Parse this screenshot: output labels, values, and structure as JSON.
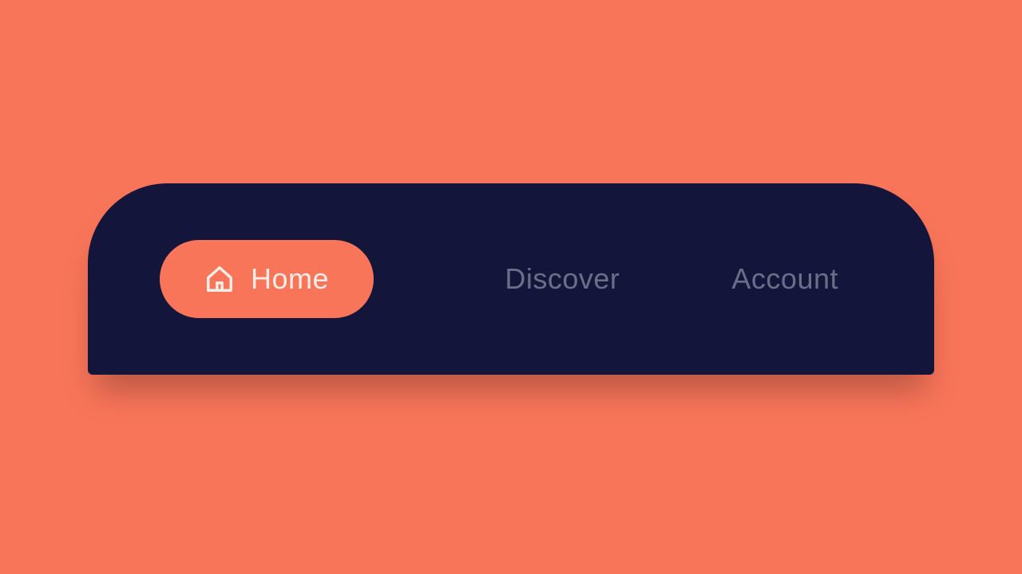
{
  "nav": {
    "items": [
      {
        "label": "Home",
        "active": true,
        "icon": "home-icon"
      },
      {
        "label": "Discover",
        "active": false
      },
      {
        "label": "Account",
        "active": false
      }
    ]
  },
  "colors": {
    "background": "#f97559",
    "navBackground": "#13163a",
    "activePill": "#f97559",
    "activeText": "#f5eee8",
    "inactiveText": "#6b6e88"
  }
}
